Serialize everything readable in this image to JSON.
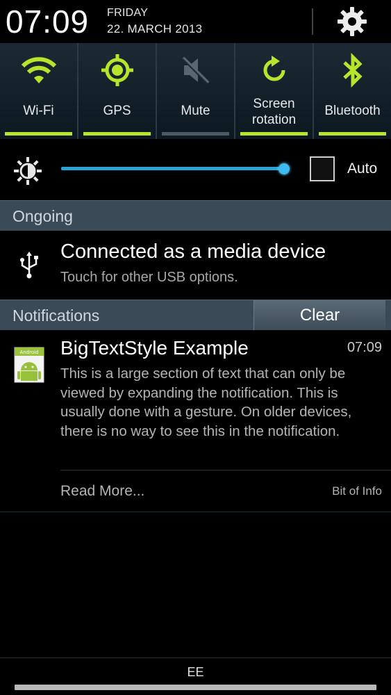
{
  "status": {
    "time": "07:09",
    "day": "FRIDAY",
    "date": "22. MARCH 2013"
  },
  "settings": {
    "icon": "gear-icon"
  },
  "toggles": [
    {
      "label": "Wi-Fi",
      "icon": "wifi-icon",
      "active": true
    },
    {
      "label": "GPS",
      "icon": "gps-icon",
      "active": true
    },
    {
      "label": "Mute",
      "icon": "mute-icon",
      "active": false
    },
    {
      "label": "Screen rotation",
      "label_line1": "Screen",
      "label_line2": "rotation",
      "icon": "rotation-icon",
      "active": true
    },
    {
      "label": "Bluetooth",
      "icon": "bluetooth-icon",
      "active": true
    }
  ],
  "brightness": {
    "level": 0.98,
    "auto_label": "Auto",
    "auto_checked": false
  },
  "ongoing": {
    "header": "Ongoing",
    "title": "Connected as a media device",
    "subtitle": "Touch for other USB options."
  },
  "notifications": {
    "header": "Notifications",
    "clear_label": "Clear",
    "items": [
      {
        "title": "BigTextStyle Example",
        "time": "07:09",
        "body": "This is a large section of text that can only be viewed by expanding the notification. This is usually done with a gesture. On older devices, there is no way to see this in the notification.",
        "action": "Read More...",
        "summary": "Bit of Info",
        "app_icon_text": "Android"
      }
    ]
  },
  "footer": {
    "carrier": "EE"
  },
  "colors": {
    "toggle_active": "#b6e52c",
    "toggle_inactive": "#4c5a63",
    "slider": "#2aa3d6",
    "section_header": "#3a4a57"
  }
}
